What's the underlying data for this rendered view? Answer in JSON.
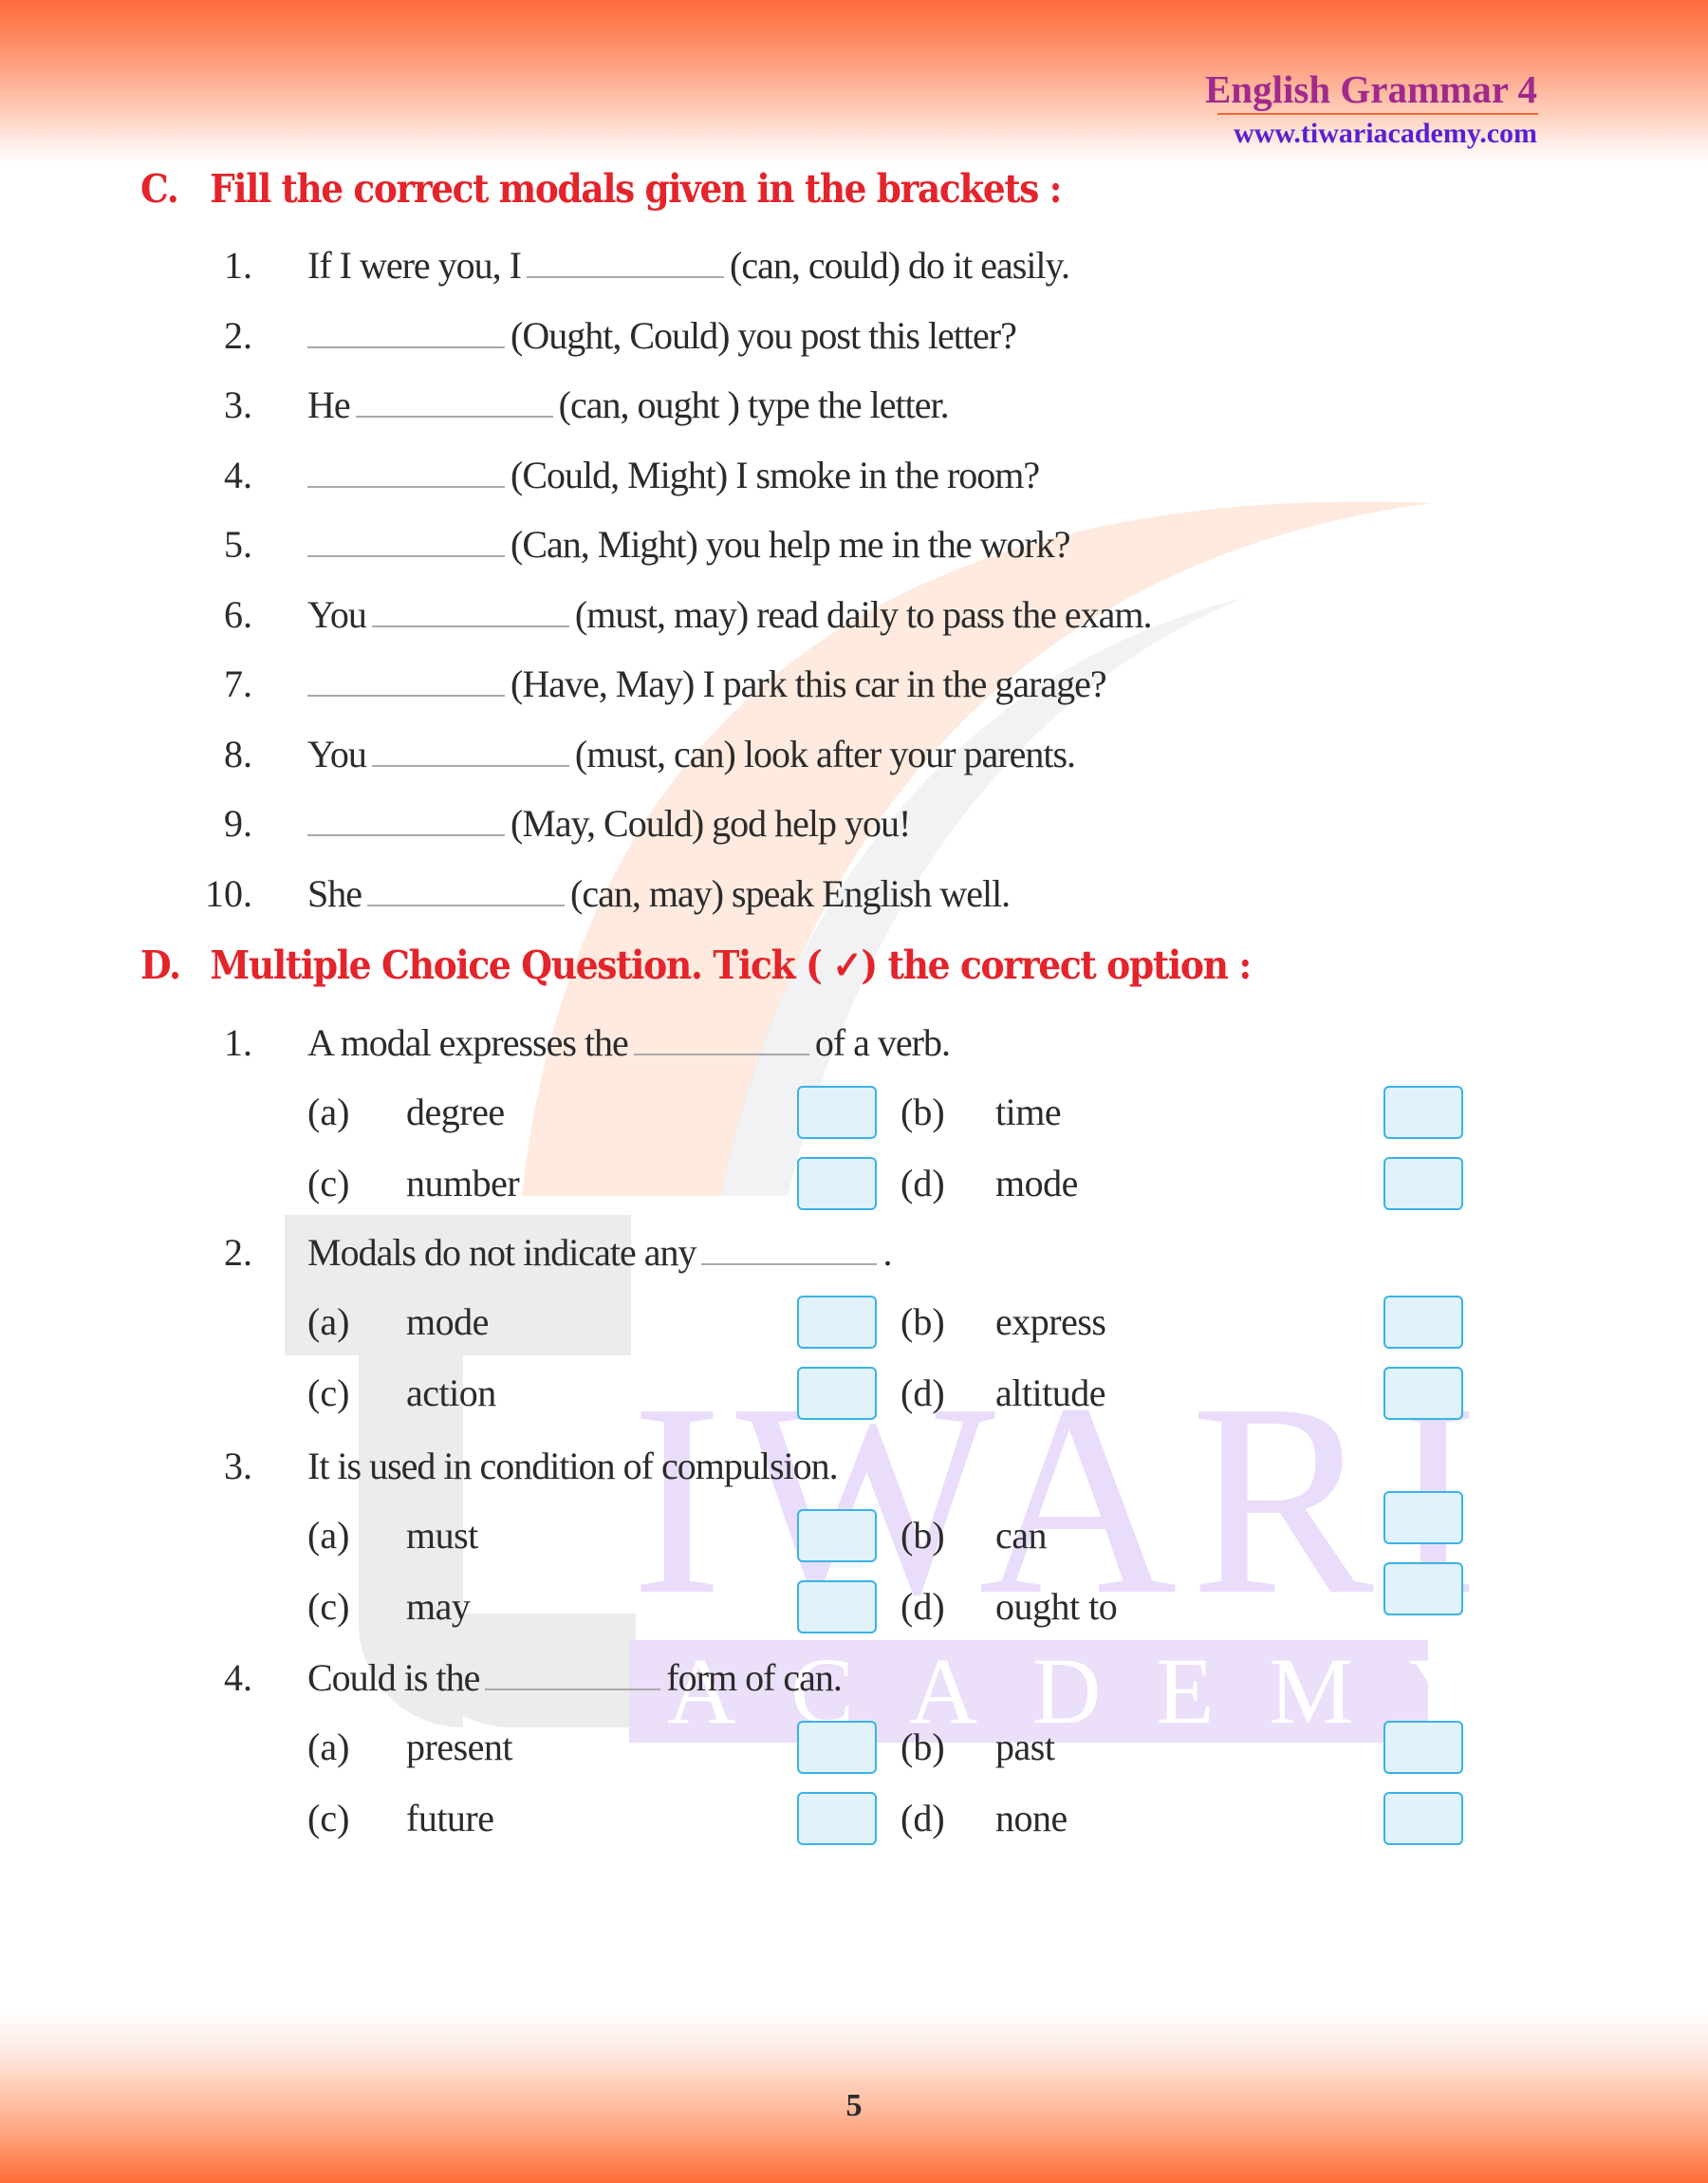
{
  "header": {
    "title": "English Grammar 4",
    "url": "www.tiwariacademy.com"
  },
  "watermark": {
    "word1": "IWARI",
    "word2": "ACADEMY"
  },
  "section_c": {
    "letter": "C.",
    "title": "Fill the correct modals given in the brackets :",
    "items": [
      {
        "num": "1.",
        "before": "If I were you, I",
        "after": "(can, could) do it easily."
      },
      {
        "num": "2.",
        "before": "",
        "after": "(Ought, Could) you post this letter?"
      },
      {
        "num": "3.",
        "before": "He",
        "after": "(can, ought ) type the letter."
      },
      {
        "num": "4.",
        "before": "",
        "after": "(Could, Might) I smoke in the room?"
      },
      {
        "num": "5.",
        "before": "",
        "after": "(Can, Might) you help me in the work?"
      },
      {
        "num": "6.",
        "before": "You",
        "after": "(must, may) read daily to pass the exam."
      },
      {
        "num": "7.",
        "before": "",
        "after": "(Have, May) I park this car in the garage?"
      },
      {
        "num": "8.",
        "before": "You",
        "after": "(must, can) look after your parents."
      },
      {
        "num": "9.",
        "before": "",
        "after": "(May, Could) god help you!"
      },
      {
        "num": "10.",
        "before": "She",
        "after": "(can, may) speak English well."
      }
    ]
  },
  "section_d": {
    "letter": "D.",
    "title": "Multiple Choice Question. Tick ( ✓) the correct option :",
    "questions": [
      {
        "num": "1.",
        "before": "A modal expresses the",
        "after": "of a verb.",
        "options": [
          {
            "label": "(a)",
            "text": "degree"
          },
          {
            "label": "(b)",
            "text": "time"
          },
          {
            "label": "(c)",
            "text": "number"
          },
          {
            "label": "(d)",
            "text": "mode"
          }
        ]
      },
      {
        "num": "2.",
        "before": "Modals do not indicate any",
        "after": ".",
        "options": [
          {
            "label": "(a)",
            "text": "mode"
          },
          {
            "label": "(b)",
            "text": "express"
          },
          {
            "label": "(c)",
            "text": "action"
          },
          {
            "label": "(d)",
            "text": "altitude"
          }
        ]
      },
      {
        "num": "3.",
        "before": "It is used in condition of compulsion.",
        "after": "",
        "options": [
          {
            "label": "(a)",
            "text": "must"
          },
          {
            "label": "(b)",
            "text": "can"
          },
          {
            "label": "(c)",
            "text": "may"
          },
          {
            "label": "(d)",
            "text": "ought to"
          }
        ]
      },
      {
        "num": "4.",
        "before": "Could is the",
        "after": "form of can.",
        "options": [
          {
            "label": "(a)",
            "text": "present"
          },
          {
            "label": "(b)",
            "text": "past"
          },
          {
            "label": "(c)",
            "text": "future"
          },
          {
            "label": "(d)",
            "text": "none"
          }
        ]
      }
    ]
  },
  "footer": {
    "page_number": "5"
  },
  "colors": {
    "heading_red": "#e3242b",
    "brand_purple": "#a02a8c",
    "url_violet": "#5a1fd0",
    "checkbox_border": "#3ab3e6",
    "checkbox_fill": "#e1f2fb",
    "band_orange": "#ff6a3a"
  }
}
